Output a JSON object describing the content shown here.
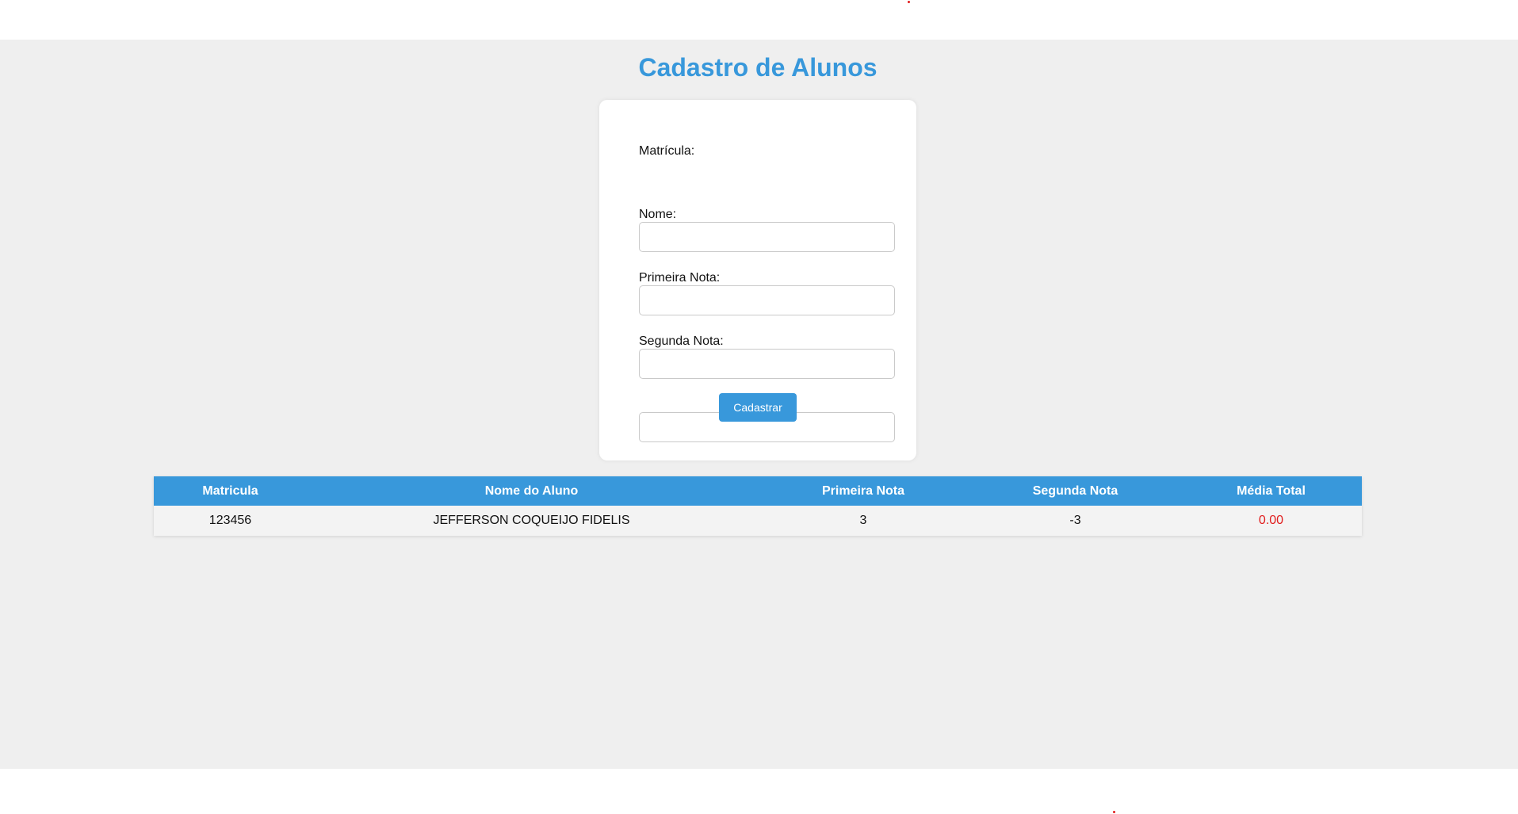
{
  "title": "Cadastro de Alunos",
  "colors": {
    "accent": "#3898db",
    "page_background": "#efefef",
    "negative_value": "#e11d1d"
  },
  "form": {
    "fields": [
      {
        "label": "Matrícula:",
        "value": "",
        "placeholder": ""
      },
      {
        "label": "Nome:",
        "value": "",
        "placeholder": ""
      },
      {
        "label": "Primeira Nota:",
        "value": "",
        "placeholder": ""
      },
      {
        "label": "Segunda Nota:",
        "value": "",
        "placeholder": ""
      }
    ],
    "submit_label": "Cadastrar"
  },
  "table": {
    "columns": [
      "Matricula",
      "Nome do Aluno",
      "Primeira Nota",
      "Segunda Nota",
      "Média Total"
    ],
    "rows": [
      {
        "matricula": "123456",
        "nome": "JEFFERSON COQUEIJO FIDELIS",
        "nota1": "3",
        "nota2": "-3",
        "media": "0.00"
      }
    ]
  }
}
